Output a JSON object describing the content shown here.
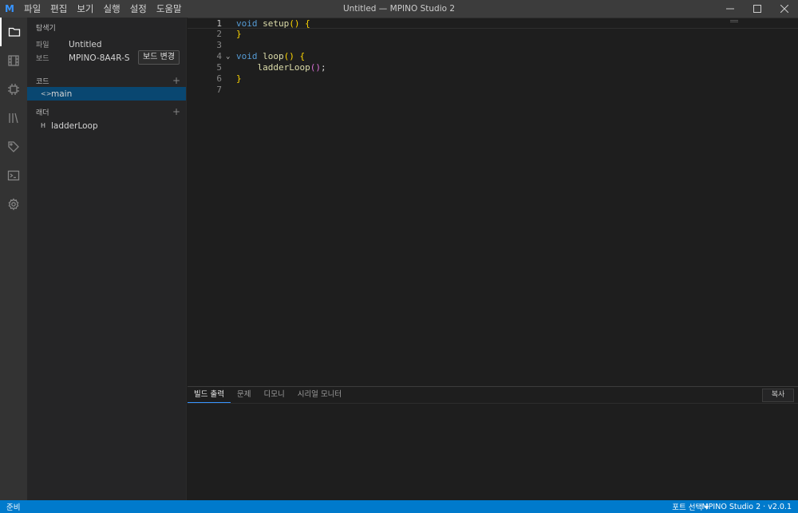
{
  "app": {
    "logo": "M",
    "window_title": "Untitled — MPINO Studio 2",
    "menu": [
      "파일",
      "편집",
      "보기",
      "실행",
      "설정",
      "도움말"
    ]
  },
  "window_controls": {
    "icons": [
      "minimize-icon",
      "maximize-icon",
      "close-icon"
    ]
  },
  "activity_bar": {
    "icons": [
      "folder-icon",
      "film-icon",
      "chip-icon",
      "library-icon",
      "tag-icon",
      "terminal-icon",
      "gear-icon"
    ],
    "active": "folder-icon"
  },
  "sidebar": {
    "title": "탐색기",
    "file_label": "파일",
    "file_value": "Untitled",
    "board_label": "보드",
    "board_value": "MPINO-8A4R-S",
    "board_button": "보드 변경",
    "code_section": "코드",
    "code_items": [
      {
        "icon": "<>",
        "label": "main"
      }
    ],
    "ladder_section": "래더",
    "ladder_items": [
      {
        "icon": "H",
        "label": "ladderLoop"
      }
    ],
    "add_symbol": "+"
  },
  "editor": {
    "line_numbers": [
      "1",
      "2",
      "3",
      "4",
      "5",
      "6",
      "7"
    ],
    "code": {
      "l1_kw": "void",
      "l1_fn": "setup",
      "l1_paren": "()",
      "l1_brace": "{",
      "l2_brace": "}",
      "l4_kw": "void",
      "l4_fn": "loop",
      "l4_paren": "()",
      "l4_brace": "{",
      "l5_fn": "ladderLoop",
      "l5_paren": "()",
      "l5_semi": ";",
      "l6_brace": "}"
    },
    "fold_glyph": "⌄"
  },
  "panel": {
    "tabs": [
      "빌드 출력",
      "문제",
      "디모니",
      "시리얼 모니터"
    ],
    "active_tab": 0,
    "copy_button": "복사"
  },
  "status_bar": {
    "left": "준비",
    "port": "포트 선택 ▾",
    "version": "MPINO Studio 2 · v2.0.1"
  },
  "colors": {
    "statusbar": "#007acc",
    "selection": "#094771",
    "keyword": "#569cd6",
    "function": "#dcdcaa",
    "bracket": "#ffd700"
  }
}
